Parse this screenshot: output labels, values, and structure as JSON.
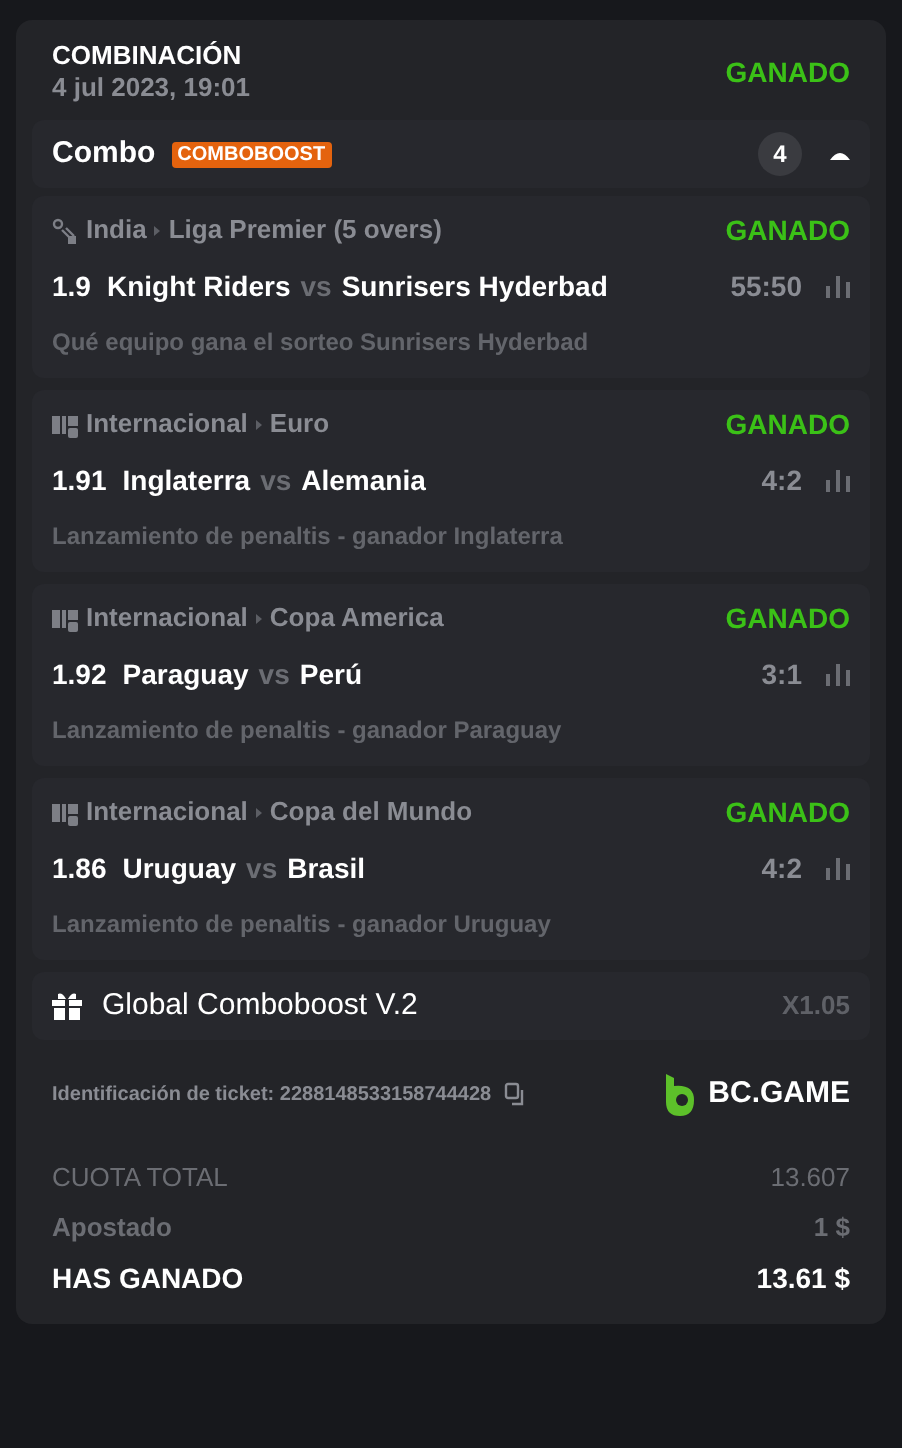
{
  "header": {
    "title": "COMBINACIÓN",
    "date": "4 jul 2023, 19:01",
    "status": "GANADO"
  },
  "combo": {
    "label": "Combo",
    "badge": "COMBOBOOST",
    "count": "4",
    "expanded": true
  },
  "matches": [
    {
      "kind": "cricket",
      "country": "India",
      "league": "Liga Premier (5 overs)",
      "status": "GANADO",
      "odds": "1.9",
      "home": "Knight Riders",
      "vs": "vs",
      "away": "Sunrisers Hyderbad",
      "score": "55:50",
      "market": "Qué equipo gana el sorteo Sunrisers Hyderbad"
    },
    {
      "kind": "fifa",
      "country": "Internacional",
      "league": "Euro",
      "status": "GANADO",
      "odds": "1.91",
      "home": "Inglaterra",
      "vs": "vs",
      "away": "Alemania",
      "score": "4:2",
      "market": "Lanzamiento de penaltis - ganador Inglaterra"
    },
    {
      "kind": "fifa",
      "country": "Internacional",
      "league": "Copa America",
      "status": "GANADO",
      "odds": "1.92",
      "home": "Paraguay",
      "vs": "vs",
      "away": "Perú",
      "score": "3:1",
      "market": "Lanzamiento de penaltis - ganador Paraguay"
    },
    {
      "kind": "fifa",
      "country": "Internacional",
      "league": "Copa del Mundo",
      "status": "GANADO",
      "odds": "1.86",
      "home": "Uruguay",
      "vs": "vs",
      "away": "Brasil",
      "score": "4:2",
      "market": "Lanzamiento de penaltis - ganador Uruguay"
    }
  ],
  "boost": {
    "label": "Global Comboboost V.2",
    "multiplier": "X1.05"
  },
  "ticket": {
    "label": "Identificación de ticket: 2288148533158744428",
    "brand": "BC.GAME"
  },
  "summary": [
    {
      "kind": "muted",
      "label": "CUOTA TOTAL",
      "value": "13.607"
    },
    {
      "kind": "muted",
      "label": "Apostado",
      "value": "1 $"
    },
    {
      "kind": "strong",
      "label": "HAS GANADO",
      "value": "13.61 $"
    }
  ]
}
